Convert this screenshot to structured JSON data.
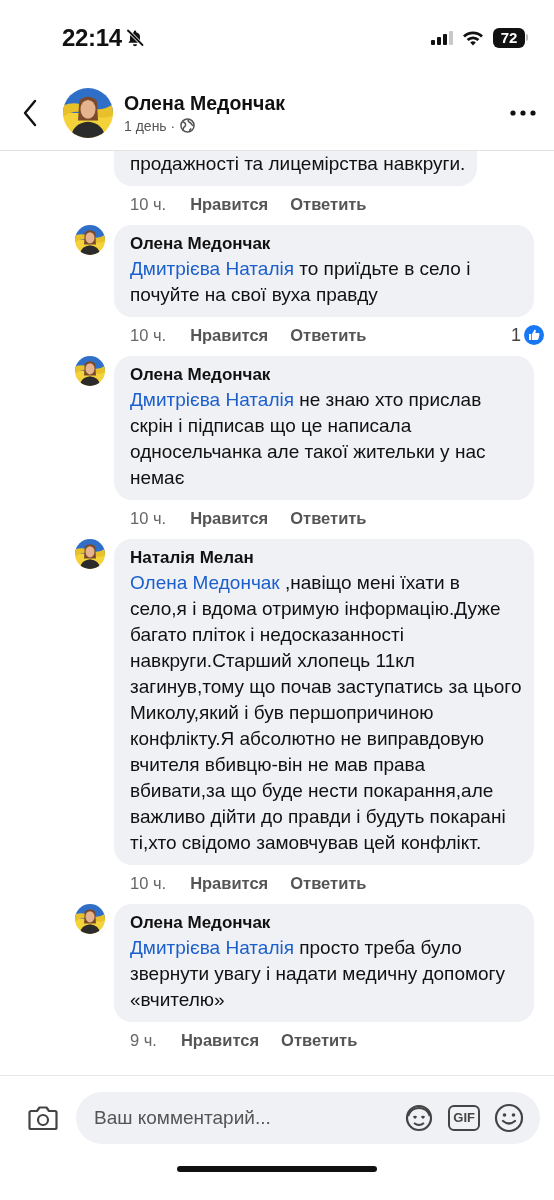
{
  "status_bar": {
    "time": "22:14",
    "battery": "72"
  },
  "header": {
    "name": "Олена Медончак",
    "age": "1 день ·"
  },
  "comments": [
    {
      "kind": "partial",
      "text": "продажності та лицемірства навкруги.",
      "time": "10 ч.",
      "like": "Нравится",
      "reply": "Ответить"
    },
    {
      "kind": "full",
      "author": "Олена Медончак",
      "mention": "Дмитрієва Наталія",
      "text": " то приїдьте в село і почуйте на свої вуха правду",
      "time": "10 ч.",
      "like": "Нравится",
      "reply": "Ответить",
      "reactions": "1"
    },
    {
      "kind": "full",
      "author": "Олена Медончак",
      "mention": "Дмитрієва Наталія",
      "text": " не знаю хто прислав скрін і підписав що це написала односельчанка але такої жительки у нас немає",
      "time": "10 ч.",
      "like": "Нравится",
      "reply": "Ответить"
    },
    {
      "kind": "full",
      "author": "Наталія Мелан",
      "mention": "Олена Медончак",
      "text": " ,навіщо мені їхати в село,я і вдома отримую інформацію.Дуже багато пліток і недосказанності навкруги.Старший хлопець 11кл загинув,тому що почав заступатись за цього Миколу,який і був першопричиною конфлікту.Я абсолютно не виправдовую вчителя вбивцю-він не мав права вбивати,за що буде нести покарання,але важливо дійти до правди і будуть покарані ті,хто свідомо замовчував цей конфлікт.",
      "time": "10 ч.",
      "like": "Нравится",
      "reply": "Ответить"
    },
    {
      "kind": "full",
      "author": "Олена Медончак",
      "mention": "Дмитрієва Наталія",
      "text": " просто треба було звернути увагу і надати медичну допомогу «вчителю»",
      "time": "9 ч.",
      "like": "Нравится",
      "reply": "Ответить"
    }
  ],
  "composer": {
    "placeholder": "Ваш комментарий...",
    "gif": "GIF"
  }
}
